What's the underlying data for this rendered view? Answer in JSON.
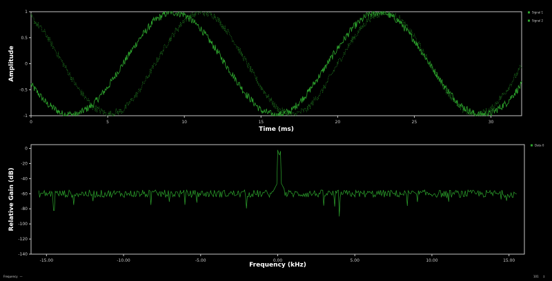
{
  "colors": {
    "background": "#000000",
    "frame": "#c8c8c8",
    "series_green": "#2ea82e",
    "series_green_dark": "#1f7a1f"
  },
  "chart_data": [
    {
      "type": "line",
      "xlabel": "Time (ms)",
      "ylabel": "Amplitude",
      "xlim": [
        0,
        32
      ],
      "ylim": [
        -1,
        1
      ],
      "x_ticks": [
        0,
        5,
        10,
        15,
        20,
        25,
        30
      ],
      "y_ticks": [
        -1,
        -0.5,
        0,
        0.5,
        1
      ],
      "grid": false,
      "legend": "top-right",
      "series": [
        {
          "name": "Signal 1",
          "style": "solid",
          "description": "noisy sinusoid, period about 9.9 ms",
          "x": [
            0,
            1,
            2,
            3,
            4,
            5,
            6,
            7,
            8,
            9,
            10,
            11,
            12,
            13,
            14,
            15,
            16,
            17,
            18,
            19,
            20,
            21,
            22,
            23,
            24,
            25,
            26,
            27,
            28,
            29,
            30,
            31,
            32
          ],
          "values": [
            -0.4,
            -0.76,
            -0.96,
            -0.98,
            -0.8,
            -0.45,
            0.0,
            0.45,
            0.82,
            1.0,
            0.95,
            0.7,
            0.3,
            -0.15,
            -0.58,
            -0.9,
            -1.0,
            -0.9,
            -0.58,
            -0.15,
            0.3,
            0.7,
            0.95,
            1.0,
            0.82,
            0.45,
            0.0,
            -0.45,
            -0.8,
            -0.98,
            -0.96,
            -0.76,
            -0.4
          ]
        },
        {
          "name": "Signal 2",
          "style": "dotted",
          "description": "noisy sinusoid, period about 9.9 ms, phase shifted",
          "x": [
            0,
            1,
            2,
            3,
            4,
            5,
            6,
            7,
            8,
            9,
            10,
            11,
            12,
            13,
            14,
            15,
            16,
            17,
            18,
            19,
            20,
            21,
            22,
            23,
            24,
            25,
            26,
            27,
            28,
            29,
            30,
            31,
            32
          ],
          "values": [
            0.9,
            0.55,
            0.05,
            -0.45,
            -0.82,
            -0.98,
            -0.9,
            -0.55,
            -0.05,
            0.45,
            0.85,
            1.0,
            0.92,
            0.55,
            0.05,
            -0.45,
            -0.85,
            -1.0,
            -0.88,
            -0.52,
            0.0,
            0.48,
            0.86,
            1.0,
            0.88,
            0.52,
            0.0,
            -0.48,
            -0.86,
            -1.0,
            -0.88,
            -0.52,
            -0.05
          ]
        }
      ]
    },
    {
      "type": "line",
      "xlabel": "Frequency (kHz)",
      "ylabel": "Relative Gain (dB)",
      "xlim": [
        -16,
        16
      ],
      "ylim": [
        -140,
        5
      ],
      "x_ticks": [
        -15,
        -10,
        -5,
        0,
        5,
        10,
        15
      ],
      "x_tick_labels": [
        "-15.00",
        "-10.00",
        "-5.00",
        "0.00",
        "5.00",
        "10.00",
        "15.00"
      ],
      "y_ticks": [
        0,
        -20,
        -40,
        -60,
        -80,
        -100,
        -120,
        -140
      ],
      "grid": false,
      "legend": "top-right",
      "series": [
        {
          "name": "Data 0",
          "description": "noise floor near -60 dB with a single spectral peak",
          "noise_floor_db": -60,
          "peaks": [
            {
              "x": 0.1,
              "y": -10
            }
          ],
          "notable_dips": [
            {
              "x": 4.0,
              "y": -90
            },
            {
              "x": -14.5,
              "y": -82
            }
          ]
        }
      ]
    }
  ],
  "status_bar": {
    "left_label": "Frequency",
    "left_glyph": "—",
    "right_value": "101",
    "right_glyph": "↕"
  }
}
